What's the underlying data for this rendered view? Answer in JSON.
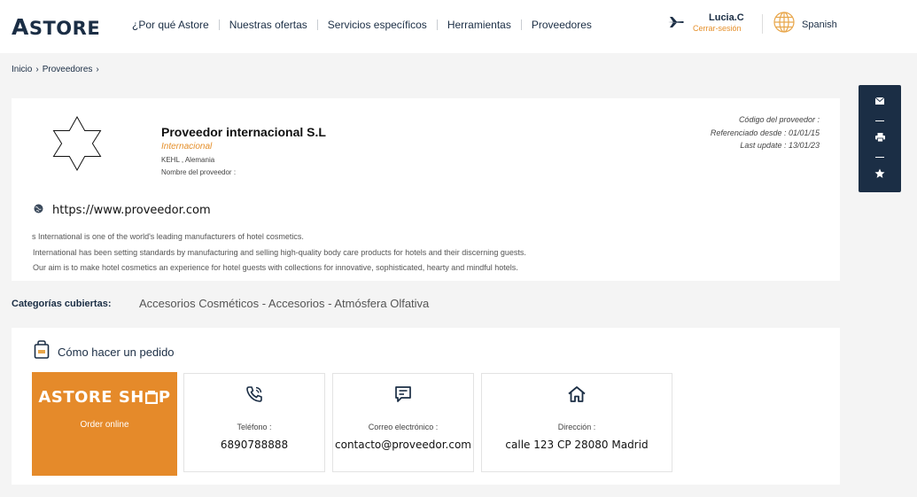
{
  "header": {
    "logo": {
      "first": "A",
      "rest": "STORE"
    },
    "nav": [
      "¿Por qué Astore",
      "Nuestras ofertas",
      "Servicios específicos",
      "Herramientas",
      "Proveedores"
    ],
    "user": {
      "name": "Lucia.C",
      "logout": "Cerrar-sesión",
      "icon": "plane-icon"
    },
    "language": {
      "label": "Spanish",
      "icon": "globe-icon"
    }
  },
  "breadcrumb": [
    "Inicio",
    "Proveedores"
  ],
  "provider": {
    "name": "Proveedor internacional S.L",
    "type": "Internacional",
    "location": "KEHL , Alemania",
    "nombre_label": "Nombre del proveedor :",
    "code_label": "Código del proveedor :",
    "referenced": "Referenciado desde : 01/01/15",
    "last_update": "Last update : 13/01/23",
    "website": "https://www.proveedor.com",
    "description": [
      "s International is one of the world's leading manufacturers of hotel cosmetics.",
      "International has been setting standards by manufacturing and selling high-quality body care products for hotels and their discerning guests.",
      "Our aim is to make hotel cosmetics an experience for hotel guests with collections for innovative, sophisticated, hearty and mindful hotels."
    ]
  },
  "sidebar": {
    "icons": [
      "mail-icon",
      "print-icon",
      "star-icon"
    ]
  },
  "categories": {
    "label": "Categorías cubiertas:",
    "value": "Accesorios Cosméticos - Accesorios - Atmósfera Olfativa"
  },
  "order": {
    "title": "Cómo hacer un pedido",
    "shop": {
      "title_a": "ASTORE SH",
      "title_b": "P",
      "subtitle": "Order online"
    },
    "phone": {
      "label": "Teléfono :",
      "value": "6890788888"
    },
    "email": {
      "label": "Correo electrónico :",
      "value": "contacto@proveedor.com"
    },
    "address": {
      "label": "Dirección :",
      "value": "calle 123 CP 28080 Madrid"
    }
  },
  "colors": {
    "navy": "#1b2e45",
    "orange": "#e58a2a",
    "background": "#f4f4f4"
  }
}
